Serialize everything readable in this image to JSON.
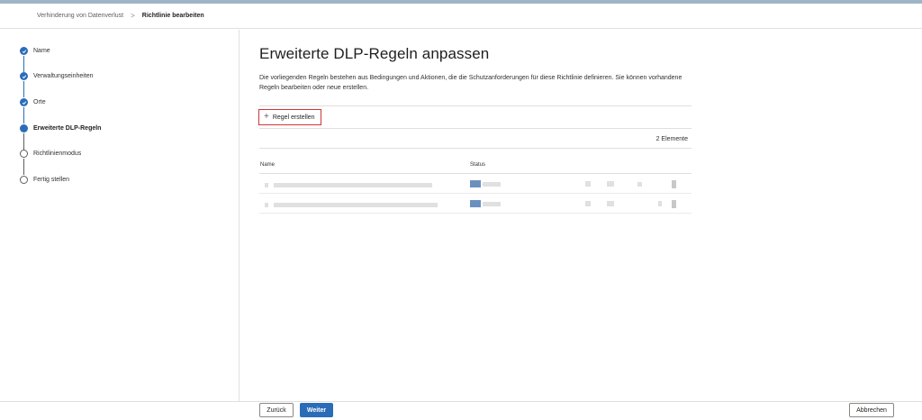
{
  "breadcrumb": {
    "parent": "Verhinderung von Datenverlust",
    "separator": ">",
    "current": "Richtlinie bearbeiten"
  },
  "steps": [
    {
      "label": "Name",
      "state": "done"
    },
    {
      "label": "Verwaltungseinheiten",
      "state": "done"
    },
    {
      "label": "Orte",
      "state": "done"
    },
    {
      "label": "Erweiterte DLP-Regeln",
      "state": "current"
    },
    {
      "label": "Richtlinienmodus",
      "state": "todo"
    },
    {
      "label": "Fertig stellen",
      "state": "todo"
    }
  ],
  "main": {
    "title": "Erweiterte DLP-Regeln anpassen",
    "description": "Die vorliegenden Regeln bestehen aus Bedingungen und Aktionen, die die Schutzanforderungen für diese Richtlinie definieren. Sie können vorhandene Regeln bearbeiten oder neue erstellen.",
    "create_rule_label": "Regel erstellen",
    "item_count": "2 Elemente",
    "columns": {
      "name": "Name",
      "status": "Status"
    }
  },
  "footer": {
    "back_label": "Zurück",
    "next_label": "Weiter",
    "cancel_label": "Abbrechen"
  },
  "colors": {
    "accent": "#2b6cb8",
    "highlight_border": "#d13438"
  }
}
